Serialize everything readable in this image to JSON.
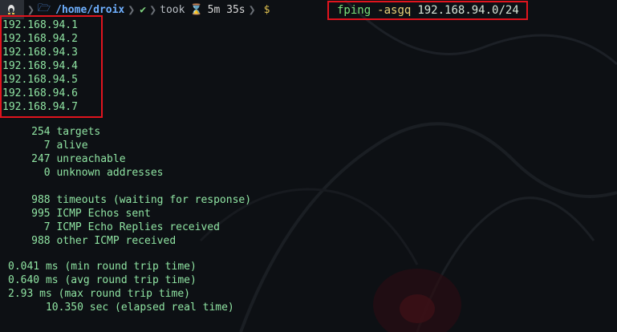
{
  "prompt": {
    "os_icon": "linux-tux-icon",
    "folder_icon": "folder-icon",
    "path": "/home/droix",
    "status_icon": "check-icon",
    "took_label": "took",
    "hourglass_icon": "hourglass-icon",
    "duration": "5m 35s",
    "prompt_symbol": "$"
  },
  "command": {
    "name": "fping",
    "flags": "-asgq",
    "argument": "192.168.94.0/24"
  },
  "alive_hosts": [
    "192.168.94.1",
    "192.168.94.2",
    "192.168.94.3",
    "192.168.94.4",
    "192.168.94.5",
    "192.168.94.6",
    "192.168.94.7"
  ],
  "summary": [
    "     254 targets",
    "       7 alive",
    "     247 unreachable",
    "       0 unknown addresses",
    "",
    "     988 timeouts (waiting for response)",
    "     995 ICMP Echos sent",
    "       7 ICMP Echo Replies received",
    "     988 other ICMP received"
  ],
  "round_trip": [
    "0.041 ms (min round trip time)",
    "0.640 ms (avg round trip time)",
    "2.93 ms (max round trip time)",
    "      10.350 sec (elapsed real time)"
  ],
  "colors": {
    "output_text": "#8fe3a2",
    "highlight_border": "#e0141e",
    "background": "#0d1014"
  }
}
